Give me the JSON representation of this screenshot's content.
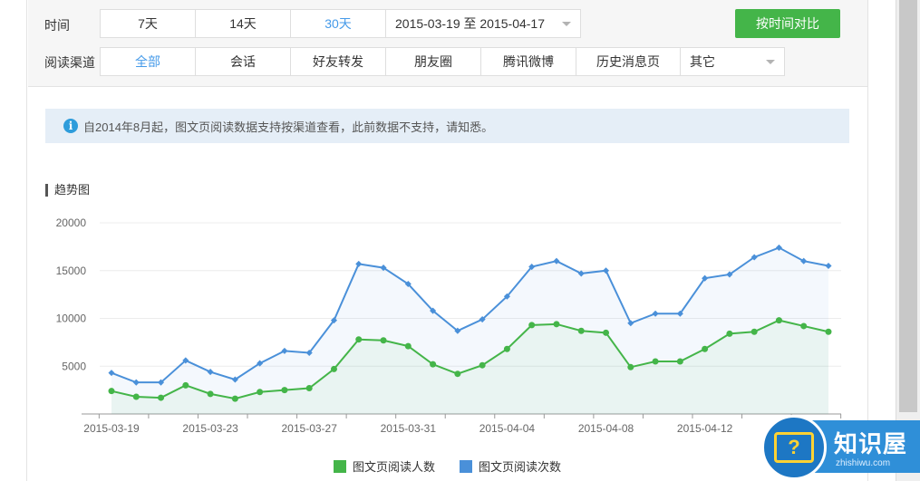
{
  "filters": {
    "time_label": "时间",
    "time_options": [
      "7天",
      "14天",
      "30天"
    ],
    "active_time_index": 2,
    "date_range": "2015-03-19 至 2015-04-17",
    "compare_button": "按时间对比",
    "channel_label": "阅读渠道",
    "channel_options": [
      "全部",
      "会话",
      "好友转发",
      "朋友圈",
      "腾讯微博",
      "历史消息页"
    ],
    "active_channel_index": 0,
    "channel_other": "其它"
  },
  "notice": {
    "icon": "info-icon",
    "text": "自2014年8月起，图文页阅读数据支持按渠道查看，此前数据不支持，请知悉。"
  },
  "section_title": "趋势图",
  "chart_data": {
    "type": "line",
    "x": [
      "2015-03-19",
      "2015-03-20",
      "2015-03-21",
      "2015-03-22",
      "2015-03-23",
      "2015-03-24",
      "2015-03-25",
      "2015-03-26",
      "2015-03-27",
      "2015-03-28",
      "2015-03-29",
      "2015-03-30",
      "2015-03-31",
      "2015-04-01",
      "2015-04-02",
      "2015-04-03",
      "2015-04-04",
      "2015-04-05",
      "2015-04-06",
      "2015-04-07",
      "2015-04-08",
      "2015-04-09",
      "2015-04-10",
      "2015-04-11",
      "2015-04-12",
      "2015-04-13",
      "2015-04-14",
      "2015-04-15",
      "2015-04-16",
      "2015-04-17"
    ],
    "x_tick_labels": [
      "2015-03-19",
      "2015-03-23",
      "2015-03-27",
      "2015-03-31",
      "2015-04-04",
      "2015-04-08",
      "2015-04-12"
    ],
    "y_ticks": [
      5000,
      10000,
      15000,
      20000
    ],
    "ylim": [
      0,
      20000
    ],
    "series": [
      {
        "name": "图文页阅读人数",
        "color": "#44b549",
        "values": [
          2400,
          1800,
          1700,
          3000,
          2100,
          1600,
          2300,
          2500,
          2700,
          4700,
          7800,
          7700,
          7100,
          5200,
          4200,
          5100,
          6800,
          9300,
          9400,
          8700,
          8500,
          4900,
          5500,
          5500,
          6800,
          8400,
          8600,
          9800,
          9200,
          8600
        ]
      },
      {
        "name": "图文页阅读次数",
        "color": "#4a90d9",
        "values": [
          4300,
          3300,
          3300,
          5600,
          4400,
          3600,
          5300,
          6600,
          6400,
          9800,
          15700,
          15300,
          13600,
          10800,
          8700,
          9900,
          12300,
          15400,
          16000,
          14700,
          15000,
          9500,
          10500,
          10500,
          14200,
          14600,
          16400,
          17400,
          16000,
          15500
        ]
      }
    ]
  },
  "watermark": {
    "icon": "question-monitor-icon",
    "title": "知识屋",
    "subtitle": "zhishiwu.com"
  }
}
